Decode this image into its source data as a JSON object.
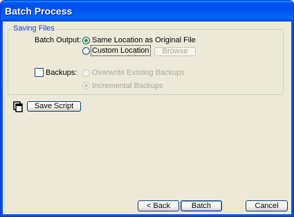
{
  "window": {
    "title": "Batch Process"
  },
  "saving_files": {
    "legend": "Saving Files",
    "batch_output_label": "Batch Output:",
    "options": [
      {
        "label": "Same Location as Original File",
        "selected": true
      },
      {
        "label": "Custom Location",
        "selected": false
      }
    ],
    "browse_label": "Browse",
    "backups_label": "Backups:",
    "backups_checked": false,
    "backup_options": [
      {
        "label": "Overwrite Existing Backups",
        "selected": false
      },
      {
        "label": "Incremental Backups",
        "selected": true
      }
    ]
  },
  "save_script": {
    "label": "Save Script",
    "icon": "copy-documents-icon"
  },
  "footer": {
    "back_label": "< Back",
    "batch_label": "Batch",
    "cancel_label": "Cancel"
  }
}
